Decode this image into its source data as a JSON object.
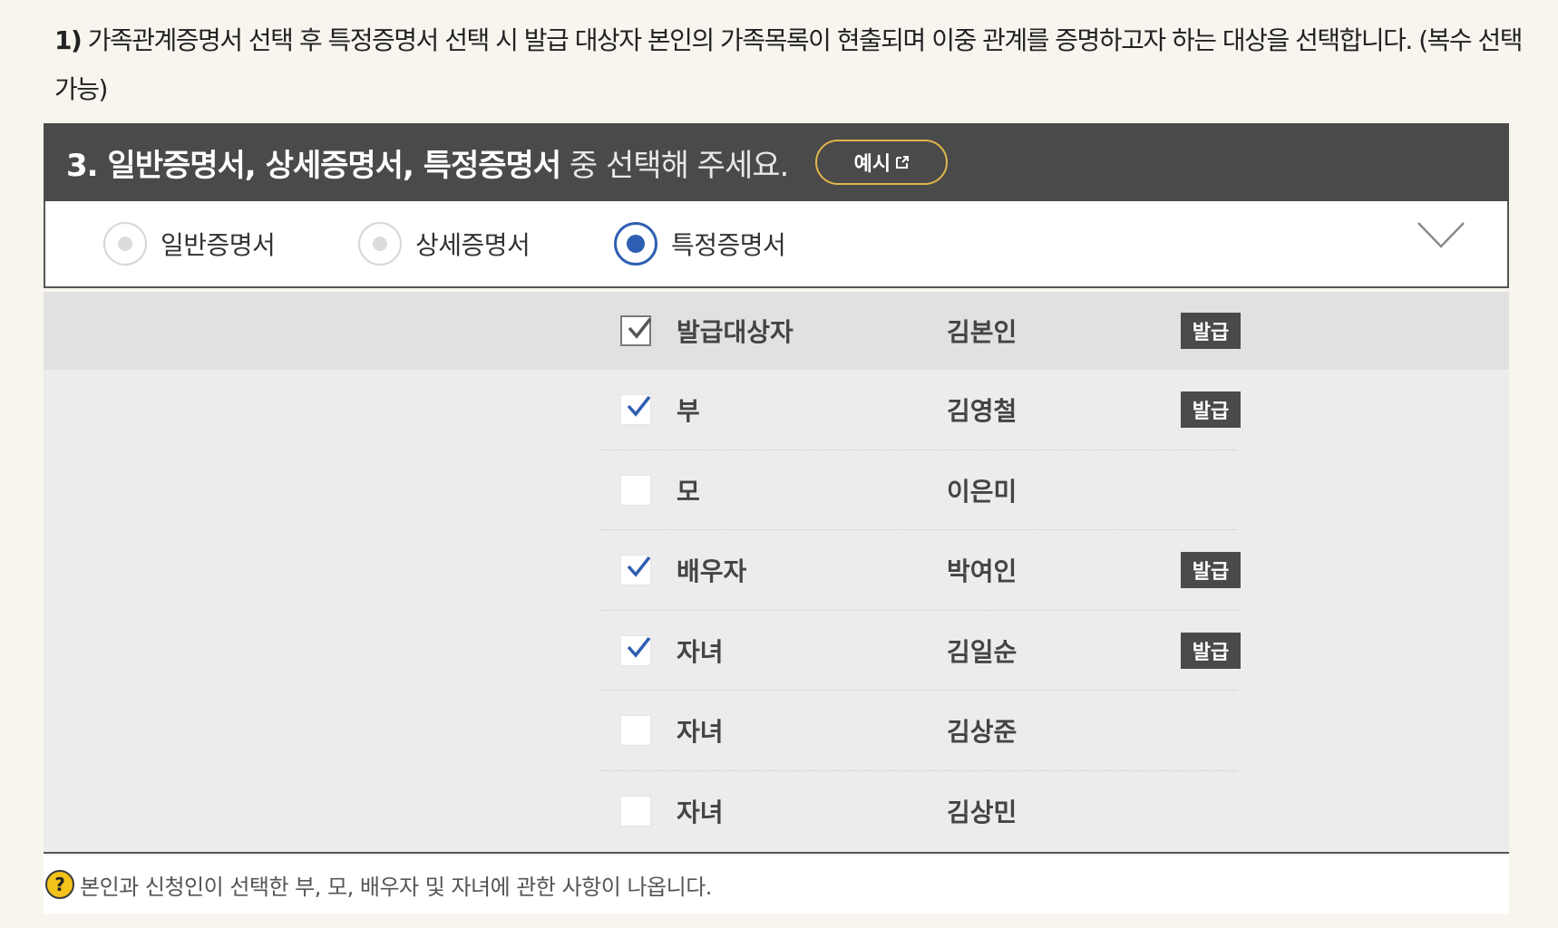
{
  "intro": {
    "number": "1)",
    "text": "가족관계증명서 선택 후 특정증명서 선택 시 발급 대상자 본인의 가족목록이 현출되며 이중 관계를 증명하고자 하는 대상을 선택합니다. (복수 선택 가능)"
  },
  "section": {
    "title_bold": "3. 일반증명서, 상세증명서, 특정증명서",
    "title_plain": " 중 선택해 주세요.",
    "example_button": "예시",
    "example_icon": "external-link-icon"
  },
  "options": [
    {
      "label": "일반증명서",
      "selected": false
    },
    {
      "label": "상세증명서",
      "selected": false
    },
    {
      "label": "특정증명서",
      "selected": true
    }
  ],
  "colors": {
    "header_bg": "#4a4a4a",
    "accent_blue": "#2f5fb2",
    "example_border": "#e2b64a",
    "badge_bg": "#4a4a4a",
    "help_icon": "#f3c21b"
  },
  "family": [
    {
      "relation": "발급대상자",
      "name": "김본인",
      "checked": true,
      "disabled": true,
      "badge": "발급"
    },
    {
      "relation": "부",
      "name": "김영철",
      "checked": true,
      "disabled": false,
      "badge": "발급"
    },
    {
      "relation": "모",
      "name": "이은미",
      "checked": false,
      "disabled": false,
      "badge": ""
    },
    {
      "relation": "배우자",
      "name": "박여인",
      "checked": true,
      "disabled": false,
      "badge": "발급"
    },
    {
      "relation": "자녀",
      "name": "김일순",
      "checked": true,
      "disabled": false,
      "badge": "발급"
    },
    {
      "relation": "자녀",
      "name": "김상준",
      "checked": false,
      "disabled": false,
      "badge": ""
    },
    {
      "relation": "자녀",
      "name": "김상민",
      "checked": false,
      "disabled": false,
      "badge": ""
    }
  ],
  "note": {
    "icon": "?",
    "text": "본인과 신청인이 선택한 부, 모, 배우자 및 자녀에 관한 사항이 나옵니다."
  }
}
